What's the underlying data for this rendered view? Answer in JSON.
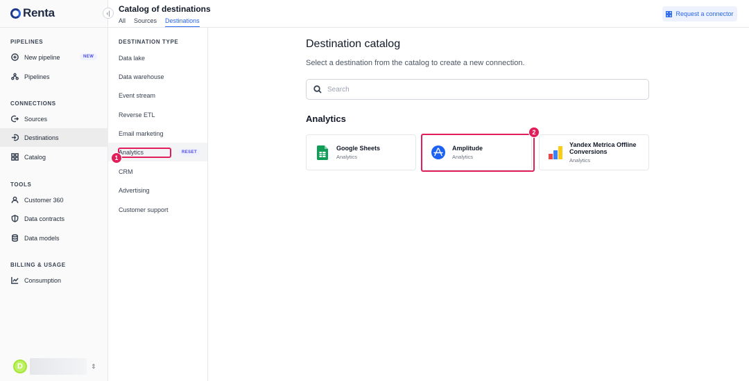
{
  "brand": {
    "name": "Renta"
  },
  "header": {
    "title": "Catalog of destinations",
    "tabs": [
      {
        "label": "All",
        "active": false
      },
      {
        "label": "Sources",
        "active": false
      },
      {
        "label": "Destinations",
        "active": true
      }
    ],
    "request_button": "Request a connector"
  },
  "sidebar": {
    "sections": [
      {
        "label": "PIPELINES"
      },
      {
        "label": "CONNECTIONS"
      },
      {
        "label": "TOOLS"
      },
      {
        "label": "BILLING & USAGE"
      }
    ],
    "items": [
      {
        "label": "New pipeline",
        "icon": "plus-circle-icon",
        "badge": "NEW"
      },
      {
        "label": "Pipelines",
        "icon": "pipelines-icon"
      },
      {
        "label": "Sources",
        "icon": "sources-icon"
      },
      {
        "label": "Destinations",
        "icon": "destinations-icon",
        "active": true
      },
      {
        "label": "Catalog",
        "icon": "catalog-grid-icon"
      },
      {
        "label": "Customer 360",
        "icon": "user-icon"
      },
      {
        "label": "Data contracts",
        "icon": "shield-icon"
      },
      {
        "label": "Data models",
        "icon": "database-icon"
      },
      {
        "label": "Consumption",
        "icon": "chart-line-icon"
      }
    ],
    "user": {
      "initial": "D"
    }
  },
  "filters": {
    "label": "DESTINATION TYPE",
    "items": [
      {
        "label": "Data lake"
      },
      {
        "label": "Data warehouse"
      },
      {
        "label": "Event stream"
      },
      {
        "label": "Reverse ETL"
      },
      {
        "label": "Email marketing"
      },
      {
        "label": "Analytics",
        "active": true
      },
      {
        "label": "CRM"
      },
      {
        "label": "Advertising"
      },
      {
        "label": "Customer support"
      }
    ],
    "reset_label": "RESET"
  },
  "main": {
    "title": "Destination catalog",
    "subtitle": "Select a destination from the catalog to create a new connection.",
    "search": {
      "placeholder": "Search",
      "value": ""
    },
    "section_title": "Analytics",
    "cards": [
      {
        "name": "Google Sheets",
        "category": "Analytics",
        "icon": "google-sheets-icon"
      },
      {
        "name": "Amplitude",
        "category": "Analytics",
        "icon": "amplitude-icon"
      },
      {
        "name": "Yandex Metrica Offline Conversions",
        "category": "Analytics",
        "icon": "yandex-metrica-icon"
      }
    ]
  },
  "annotations": [
    {
      "number": "1"
    },
    {
      "number": "2"
    }
  ],
  "colors": {
    "accent": "#2563eb",
    "annotation": "#e11d5a",
    "badge_bg": "#eef2ff"
  }
}
